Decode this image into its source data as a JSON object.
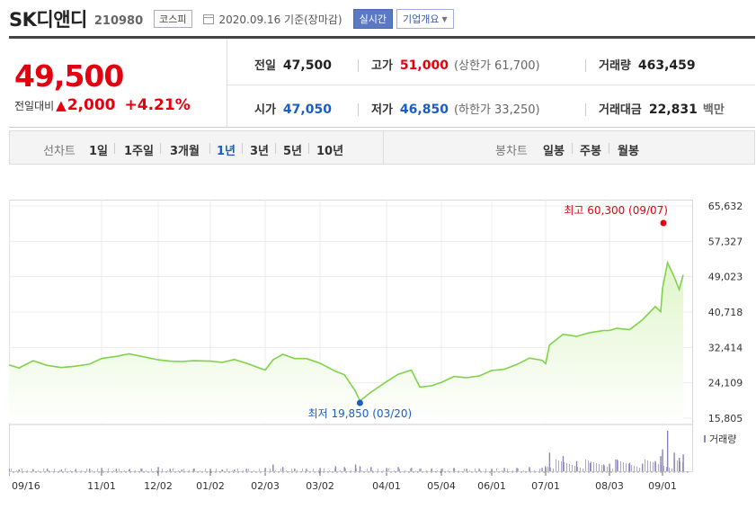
{
  "stock": {
    "name": "SK디앤디",
    "code": "210980",
    "market": "코스피",
    "date": "2020.09.16 기준(장마감)",
    "realtime_label": "실시간",
    "company_info_label": "기업개요"
  },
  "price": {
    "current": "49,500",
    "change_label": "전일대비",
    "change_arrow": "▲",
    "change_amount": "2,000",
    "change_percent": "+4.21%"
  },
  "quote": {
    "prev_close_label": "전일",
    "prev_close": "47,500",
    "high_label": "고가",
    "high": "51,000",
    "upper_limit": "(상한가 61,700)",
    "volume_label": "거래량",
    "volume": "463,459",
    "open_label": "시가",
    "open": "47,050",
    "low_label": "저가",
    "low": "46,850",
    "lower_limit": "(하한가 33,250)",
    "trade_value_label": "거래대금",
    "trade_value": "22,831",
    "trade_value_unit": "백만"
  },
  "periods": {
    "line_label": "선차트",
    "line_items": [
      "1일",
      "1주일",
      "3개월",
      "1년",
      "3년",
      "5년",
      "10년"
    ],
    "selected": "1년",
    "candle_label": "봉차트",
    "candle_items": [
      "일봉",
      "주봉",
      "월봉"
    ]
  },
  "colors": {
    "up": "#e3000f",
    "down": "#1a5ec2",
    "line": "#7fd34a",
    "area": "#dff5c9",
    "volume": "#8a82b8"
  },
  "chart_data": {
    "type": "area",
    "y_ticks": [
      "65,632",
      "57,327",
      "49,023",
      "40,718",
      "32,414",
      "24,109",
      "15,805"
    ],
    "ylim": [
      15805,
      65632
    ],
    "x_ticks": [
      "09/16",
      "11/01",
      "12/02",
      "01/02",
      "02/03",
      "03/02",
      "04/01",
      "05/04",
      "06/01",
      "07/01",
      "08/03",
      "09/01"
    ],
    "high_annotation": "최고 60,300 (09/07)",
    "low_annotation": "최저 19,850 (03/20)",
    "volume_label": "거래량",
    "price_series": [
      [
        "09/16",
        28300
      ],
      [
        "09/21",
        27600
      ],
      [
        "09/28",
        29300
      ],
      [
        "10/05",
        28200
      ],
      [
        "10/12",
        27700
      ],
      [
        "10/19",
        28000
      ],
      [
        "10/26",
        28500
      ],
      [
        "11/01",
        29800
      ],
      [
        "11/09",
        30300
      ],
      [
        "11/16",
        30900
      ],
      [
        "11/23",
        30300
      ],
      [
        "12/02",
        29500
      ],
      [
        "12/09",
        29200
      ],
      [
        "12/16",
        29100
      ],
      [
        "12/23",
        29300
      ],
      [
        "01/02",
        29200
      ],
      [
        "01/09",
        28900
      ],
      [
        "01/16",
        29600
      ],
      [
        "01/23",
        28700
      ],
      [
        "02/03",
        27100
      ],
      [
        "02/07",
        29500
      ],
      [
        "02/12",
        30800
      ],
      [
        "02/18",
        29800
      ],
      [
        "02/24",
        29800
      ],
      [
        "03/02",
        28700
      ],
      [
        "03/09",
        26800
      ],
      [
        "03/13",
        26000
      ],
      [
        "03/18",
        22100
      ],
      [
        "03/20",
        19850
      ],
      [
        "03/25",
        21900
      ],
      [
        "04/01",
        24400
      ],
      [
        "04/08",
        26100
      ],
      [
        "04/16",
        27100
      ],
      [
        "04/21",
        23100
      ],
      [
        "04/28",
        23400
      ],
      [
        "05/04",
        24200
      ],
      [
        "05/11",
        25600
      ],
      [
        "05/18",
        25300
      ],
      [
        "05/25",
        25700
      ],
      [
        "06/01",
        27000
      ],
      [
        "06/08",
        27300
      ],
      [
        "06/15",
        28400
      ],
      [
        "06/22",
        29900
      ],
      [
        "06/29",
        29400
      ],
      [
        "07/01",
        28600
      ],
      [
        "07/03",
        33000
      ],
      [
        "07/10",
        35500
      ],
      [
        "07/17",
        35000
      ],
      [
        "07/24",
        35900
      ],
      [
        "07/31",
        36400
      ],
      [
        "08/03",
        36400
      ],
      [
        "08/07",
        36900
      ],
      [
        "08/14",
        36600
      ],
      [
        "08/21",
        38900
      ],
      [
        "08/28",
        42000
      ],
      [
        "08/31",
        40800
      ],
      [
        "09/01",
        46300
      ],
      [
        "09/04",
        52300
      ],
      [
        "09/08",
        49000
      ],
      [
        "09/11",
        46000
      ],
      [
        "09/16",
        49500
      ]
    ],
    "volume_series": [
      3,
      2,
      2,
      3,
      2,
      2,
      3,
      4,
      3,
      2,
      3,
      5,
      3,
      2,
      3,
      3,
      2,
      2,
      3,
      4,
      8,
      5,
      3,
      3,
      4,
      6,
      5,
      8,
      6,
      5,
      4,
      5,
      4,
      3,
      3,
      3,
      4,
      3,
      3,
      3,
      4,
      4,
      5,
      4,
      5,
      22,
      18,
      12,
      10,
      8,
      9,
      14,
      10,
      9,
      12,
      18,
      26,
      48,
      22,
      16,
      20
    ]
  }
}
